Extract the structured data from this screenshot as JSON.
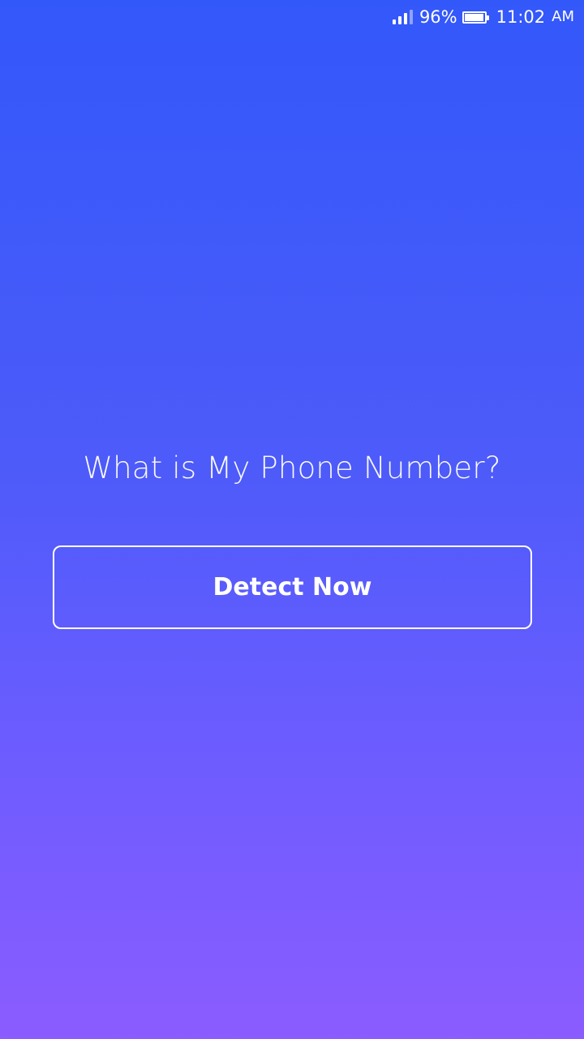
{
  "status_bar": {
    "signal_icon": "signal-bars-icon",
    "battery_percent_label": "96%",
    "battery_level": 0.96,
    "battery_icon": "battery-icon",
    "time": "11:02",
    "ampm": "AM"
  },
  "main": {
    "headline": "What is My Phone Number?",
    "detect_button_label": "Detect Now"
  },
  "colors": {
    "gradient_top": "#3358fa",
    "gradient_bottom": "#8b5cff",
    "text": "#ffffff"
  }
}
